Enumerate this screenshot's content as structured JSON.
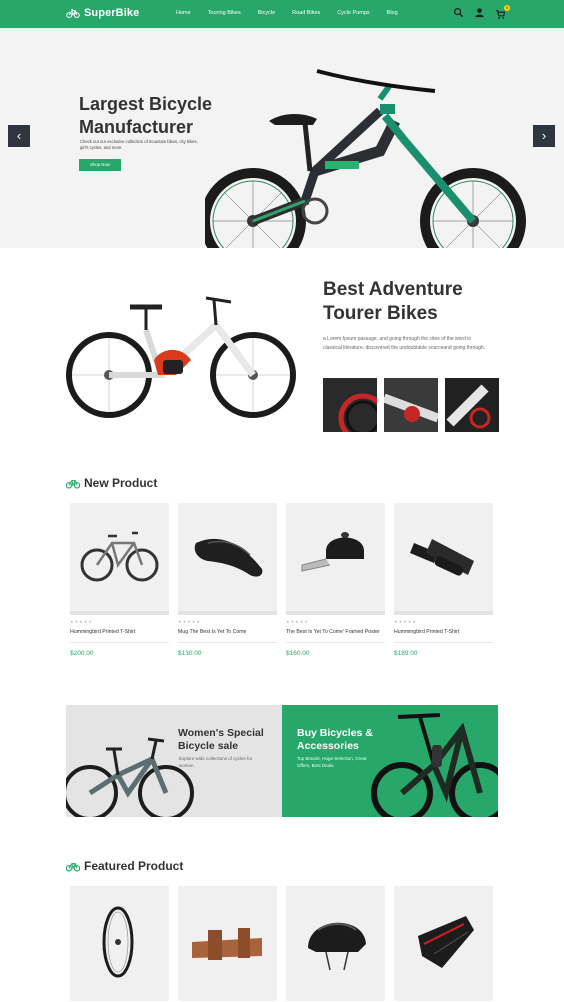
{
  "header": {
    "logo_text": "SuperBike",
    "nav": [
      "Home",
      "Touring Bikes",
      "Bicycle",
      "Road Bikes",
      "Cycle Pumps",
      "Blog"
    ],
    "cart_count": "0"
  },
  "hero": {
    "title": "Largest Bicycle Manufacturer",
    "description": "Check out our exclusive collection of mountain bikes, city bikes, girl's cycles, and more.",
    "button": "Shop Now",
    "prev_arrow": "‹",
    "next_arrow": "›"
  },
  "adventure": {
    "title": "Best Adventure Tourer Bikes",
    "description": "a Lorem Ipsum passage, and going through the cites of the word in classical literature, discovered the undoubtable sourceand going through."
  },
  "new_product": {
    "heading": "New Product",
    "items": [
      {
        "name": "Hummingbird Printed T-Shirt",
        "price": "$200.00",
        "stars": "★★★★★"
      },
      {
        "name": "Mug The Best Is Yet To Come",
        "price": "$130.00",
        "stars": "★★★★★"
      },
      {
        "name": "The Best Is Yet To Come' Framed Poster",
        "price": "$160.00",
        "stars": "★★★★★"
      },
      {
        "name": "Hummingbird Printed T-Shirt",
        "price": "$189.00",
        "stars": "★★★★★"
      }
    ]
  },
  "promo": {
    "left_title": "Women's Special Bicycle sale",
    "left_sub": "Explore wide collections of cycles for women.",
    "right_title": "Buy Bicycles & Accessories",
    "right_sub": "Top Brands, Huge Selection, Great Offers, Best Deals."
  },
  "featured": {
    "heading": "Featured Product"
  },
  "colors": {
    "accent": "#27a86a",
    "dark": "#2f3640"
  }
}
